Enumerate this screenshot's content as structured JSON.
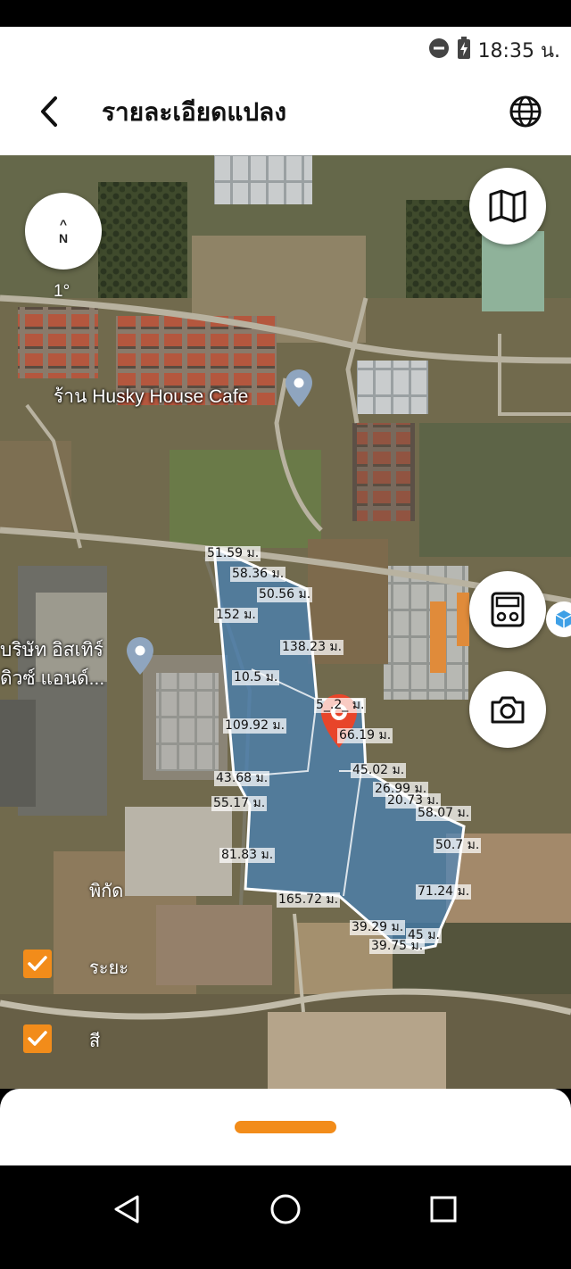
{
  "status": {
    "time": "18:35 น."
  },
  "header": {
    "title": "รายละเอียดแปลง"
  },
  "map": {
    "compass": {
      "arrow": "^",
      "letter": "N"
    },
    "rotation": "1°",
    "pois": [
      {
        "label": "ร้าน Husky House Cafe"
      },
      {
        "line1": "บริษัท อิสเทิร์",
        "line2": "ดิวซ์ แอนด์..."
      }
    ],
    "measurements": [
      "51.59 ม.",
      "58.36 ม.",
      "50.56 ม.",
      "152 ม.",
      "138.23 ม.",
      "10.5 ม.",
      "5_.2_ ม.",
      "109.92 ม.",
      "66.19 ม.",
      "45.02 ม.",
      "43.68 ม.",
      "26.99 ม.",
      "20.73 ม.",
      "55.17 ม.",
      "58.07 ม.",
      "50.7 ม.",
      "81.83 ม.",
      "71.24 ม.",
      "165.72 ม.",
      "39.29 ม.",
      "45 ม.",
      "39.75 ม."
    ],
    "layers": [
      {
        "label": "พิกัด",
        "checked": false
      },
      {
        "label": "ระยะ",
        "checked": true
      },
      {
        "label": "สี",
        "checked": true
      }
    ],
    "colors": {
      "parcel": "#3f86c9",
      "accent": "#f28c1a",
      "pin": "#e8452a"
    }
  },
  "icons": {
    "back": "back-arrow-icon",
    "globe": "globe-icon",
    "map_layers": "map-icon",
    "measure": "ruler-device-icon",
    "camera": "camera-icon"
  }
}
